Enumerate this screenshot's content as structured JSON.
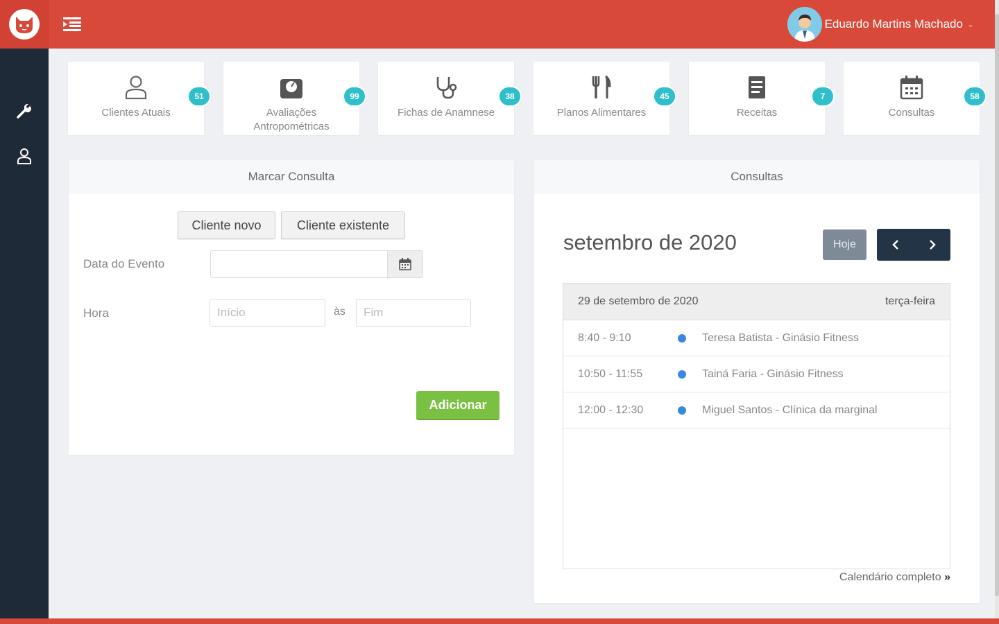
{
  "header": {
    "user_name": "Eduardo Martins Machado"
  },
  "stats": [
    {
      "label": "Clientes Atuais",
      "count": "51",
      "icon": "user-icon"
    },
    {
      "label": "Avaliações Antropométricas",
      "count": "99",
      "icon": "scale-icon"
    },
    {
      "label": "Fichas de Anamnese",
      "count": "38",
      "icon": "stethoscope-icon"
    },
    {
      "label": "Planos Alimentares",
      "count": "45",
      "icon": "fork-knife-icon"
    },
    {
      "label": "Receitas",
      "count": "7",
      "icon": "document-icon"
    },
    {
      "label": "Consultas",
      "count": "58",
      "icon": "calendar-icon"
    }
  ],
  "booking": {
    "title": "Marcar Consulta",
    "new_client": "Cliente novo",
    "existing_client": "Cliente existente",
    "date_label": "Data do Evento",
    "date_value": "",
    "time_label": "Hora",
    "start_placeholder": "Início",
    "separator": "às",
    "end_placeholder": "Fim",
    "add_button": "Adicionar"
  },
  "agenda": {
    "title": "Consultas",
    "month": "setembro de 2020",
    "today_button": "Hoje",
    "day_date": "29 de setembro de 2020",
    "day_name": "terça-feira",
    "events": [
      {
        "time": "8:40 - 9:10",
        "title": "Teresa Batista - Ginásio Fitness"
      },
      {
        "time": "10:50 - 11:55",
        "title": "Tainá Faria - Ginásio Fitness"
      },
      {
        "time": "12:00 - 12:30",
        "title": "Miguel Santos - Clínica da marginal"
      }
    ],
    "dot_color": "#3a87e0",
    "full_calendar_link": "Calendário completo"
  },
  "colors": {
    "brand": "#d9493a",
    "sidebar": "#1e2a37",
    "badge": "#2fbfca",
    "success": "#7ac143",
    "nav": "#233446"
  }
}
